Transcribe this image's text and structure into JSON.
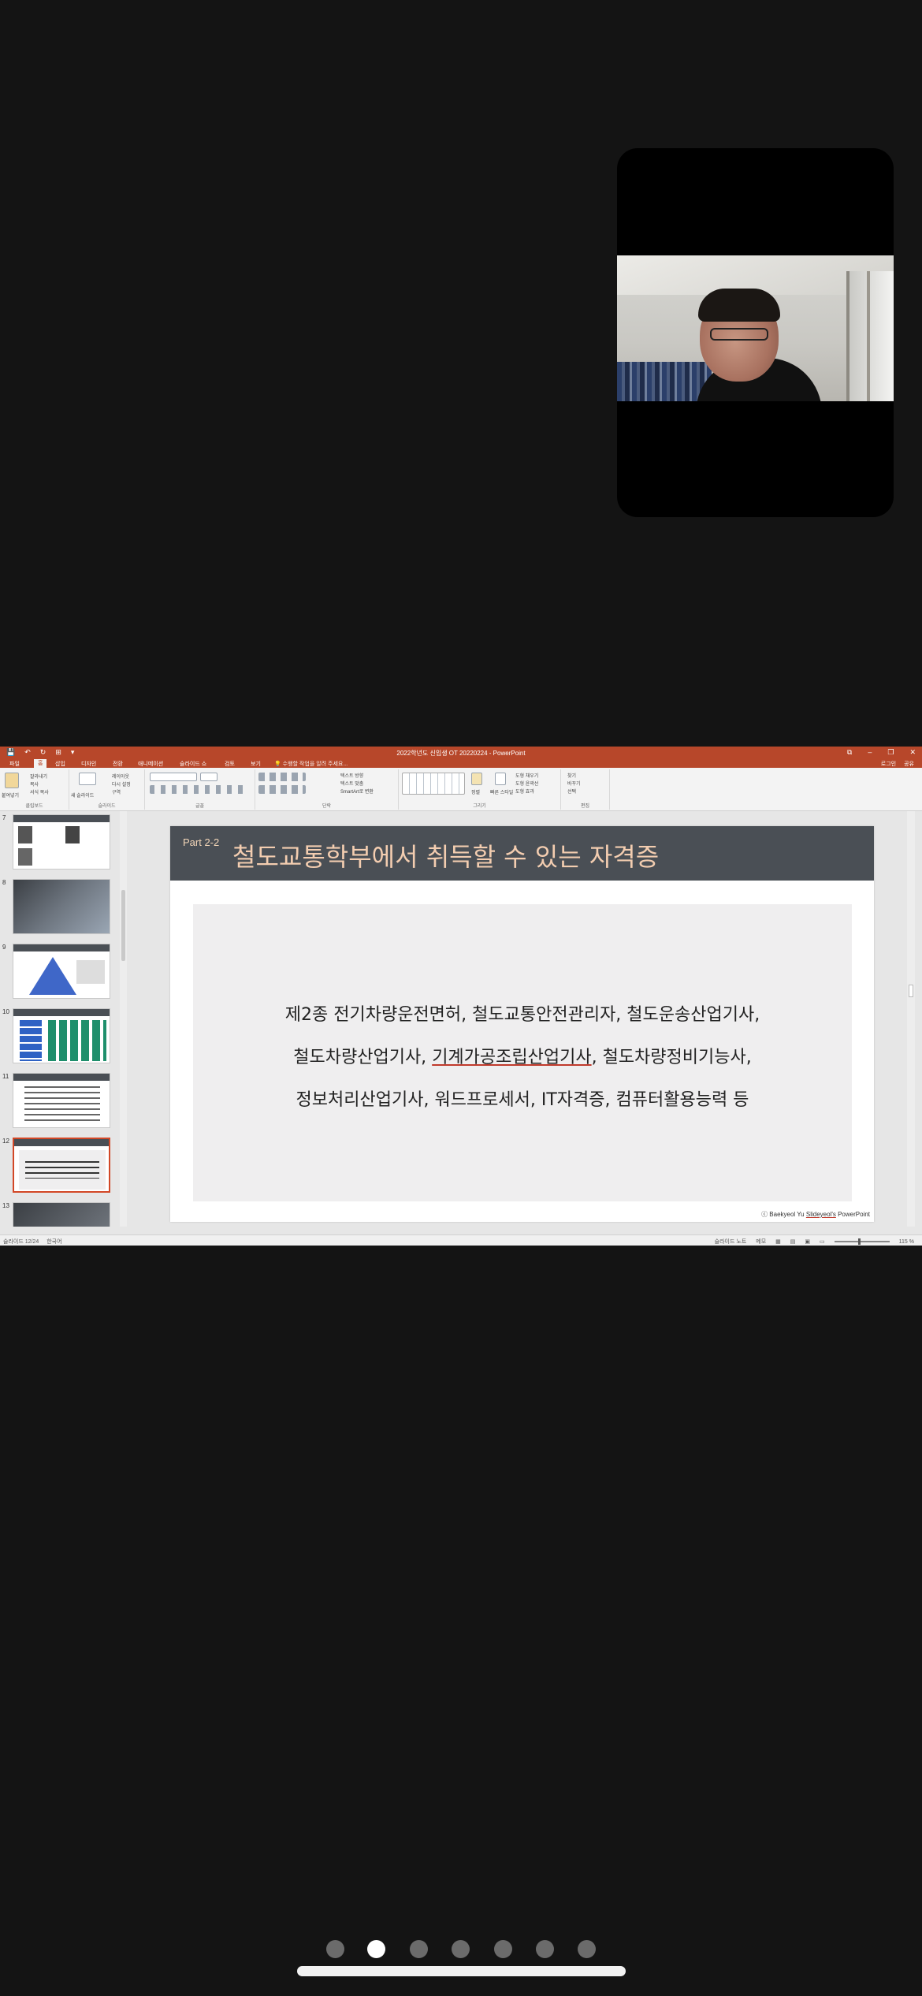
{
  "app": {
    "window_title": "2022학년도 신입생 OT 20220224 - PowerPoint",
    "tabs": [
      "파일",
      "홈",
      "삽입",
      "디자인",
      "전환",
      "애니메이션",
      "슬라이드 쇼",
      "검토",
      "보기"
    ],
    "active_tab": "홈",
    "tell_me_placeholder": "수행할 작업을 알려 주세요...",
    "login": "로그인",
    "share": "공유",
    "window_controls": [
      "⧉",
      "–",
      "❐",
      "✕"
    ],
    "qat": [
      "💾",
      "↶",
      "↻",
      "⊞",
      "▾"
    ]
  },
  "ribbon": {
    "clipboard": {
      "paste": "붙여넣기",
      "cut": "잘라내기",
      "copy": "복사",
      "format_painter": "서식 복사",
      "group": "클립보드"
    },
    "slides": {
      "new_slide": "새 슬라이드",
      "layout": "레이아웃",
      "reset": "다시 설정",
      "section": "구역",
      "group": "슬라이드"
    },
    "font": {
      "group": "글꼴"
    },
    "paragraph": {
      "text_direction": "텍스트 방향",
      "align_text": "텍스트 맞춤",
      "smartart": "SmartArt로 변환",
      "group": "단락"
    },
    "drawing": {
      "arrange": "정렬",
      "quick_styles": "빠른 스타일",
      "fill": "도형 채우기",
      "outline": "도형 윤곽선",
      "effects": "도형 효과",
      "group": "그리기"
    },
    "editing": {
      "find": "찾기",
      "replace": "바꾸기",
      "select": "선택",
      "group": "편집"
    }
  },
  "thumbnails": [
    {
      "num": "7",
      "star": "★",
      "header": "교수님 소개"
    },
    {
      "num": "8",
      "star": "★",
      "header": ""
    },
    {
      "num": "9",
      "star": "★",
      "header": "학습방향 / 진로 소개"
    },
    {
      "num": "10",
      "star": "★",
      "header": "교과과정 · 졸업 및 취업 로드맵"
    },
    {
      "num": "11",
      "star": "★",
      "header": "졸업 후 진로"
    },
    {
      "num": "12",
      "star": "★",
      "header": "철도교통학부에서 취득할 수 있는 자격증",
      "selected": true
    },
    {
      "num": "13",
      "star": "★",
      "header": ""
    }
  ],
  "slide": {
    "part": "Part 2-2",
    "title": "철도교통학부에서 취득할 수 있는 자격증",
    "line1": "제2종 전기차량운전면허,  철도교통안전관리자,  철도운송산업기사,",
    "line2_a": "철도차량산업기사,  ",
    "line2_u": "기계가공조립산업기사",
    "line2_b": ", 철도차량정비기능사,",
    "line3": "정보처리산업기사, 워드프로세서,  IT자격증,  컴퓨터활용능력 등",
    "footer_a": "ⓒ Baekyeol Yu  ",
    "footer_u": "Slideyeol's",
    "footer_b": " PowerPoint"
  },
  "statusbar": {
    "slide_info": "슬라이드 12/24",
    "language": "한국어",
    "notes": "슬라이드 노트",
    "comments": "메모",
    "zoom": "115 %"
  },
  "page_dots": {
    "count": 7,
    "active_index": 1
  },
  "colors": {
    "powerpoint_accent": "#b7472a",
    "slide_header": "#4a4f55",
    "slide_title": "#f3cdb0",
    "background": "#141414"
  }
}
